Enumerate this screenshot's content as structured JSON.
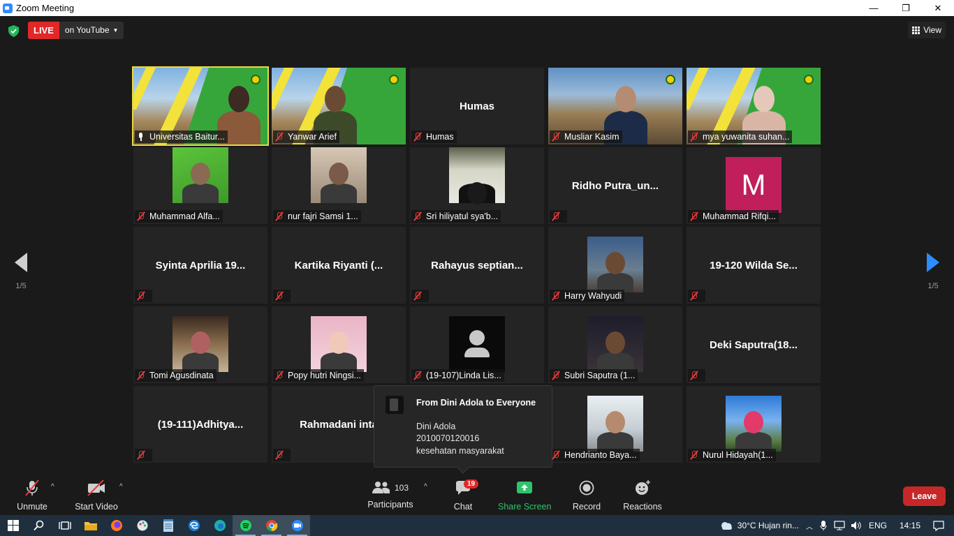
{
  "window": {
    "title": "Zoom Meeting",
    "controls": [
      "—",
      "❐",
      "✕"
    ]
  },
  "topbar": {
    "live_label": "LIVE",
    "stream_label": "on YouTube",
    "view_label": "View"
  },
  "pager": {
    "left_page": "1/5",
    "right_page": "1/5"
  },
  "tiles": [
    {
      "name": "Universitas Baitur...",
      "video": true
    },
    {
      "name": "Yanwar Arief",
      "video": true
    },
    {
      "name": "Humas",
      "center": "Humas",
      "video": false
    },
    {
      "name": "Musliar Kasim",
      "video": true
    },
    {
      "name": "mya yuwanita suhan...",
      "video": true
    },
    {
      "name": "Muhammad Alfa...",
      "video": true
    },
    {
      "name": "nur fajri Samsi 1...",
      "video": true
    },
    {
      "name": "Sri hiliyatul sya'b...",
      "video": true
    },
    {
      "name": "",
      "center": "Ridho  Putra_un...",
      "video": false
    },
    {
      "name": "Muhammad Rifqi...",
      "avatar_letter": "M"
    },
    {
      "name": "",
      "center": "Syinta Aprilia 19...",
      "video": false
    },
    {
      "name": "",
      "center": "Kartika Riyanti (...",
      "video": false
    },
    {
      "name": "",
      "center": "Rahayus  septian...",
      "video": false
    },
    {
      "name": "Harry Wahyudi",
      "video": true
    },
    {
      "name": "",
      "center": "19-120  Wilda Se...",
      "video": false
    },
    {
      "name": "Tomi Agusdinata",
      "video": true
    },
    {
      "name": "Popy hutri Ningsi...",
      "video": true
    },
    {
      "name": "(19-107)Linda Lis...",
      "avatar": "generic"
    },
    {
      "name": "Subri Saputra (1...",
      "video": true
    },
    {
      "name": "",
      "center": "Deki  Saputra(18...",
      "video": false
    },
    {
      "name": "",
      "center": "(19-111)Adhitya...",
      "video": false
    },
    {
      "name": "",
      "center": "Rahmadani  inta",
      "video": false
    },
    {
      "name": "",
      "center": "",
      "video": false
    },
    {
      "name": "Hendrianto Baya...",
      "video": true
    },
    {
      "name": "Nurul Hidayah(1...",
      "video": true
    }
  ],
  "chat_popup": {
    "from": "From Dini Adola to Everyone",
    "lines": [
      "Dini Adola",
      "2010070120016",
      "kesehatan masyarakat"
    ]
  },
  "toolbar": {
    "unmute": "Unmute",
    "start_video": "Start Video",
    "participants": "Participants",
    "participants_count": "103",
    "chat": "Chat",
    "chat_badge": "19",
    "share_screen": "Share Screen",
    "record": "Record",
    "reactions": "Reactions",
    "leave": "Leave",
    "share_color": "#2fc36b",
    "leave_color": "#c62828"
  },
  "taskbar": {
    "weather": "30°C  Hujan rin...",
    "language": "ENG",
    "time": "14:15"
  }
}
